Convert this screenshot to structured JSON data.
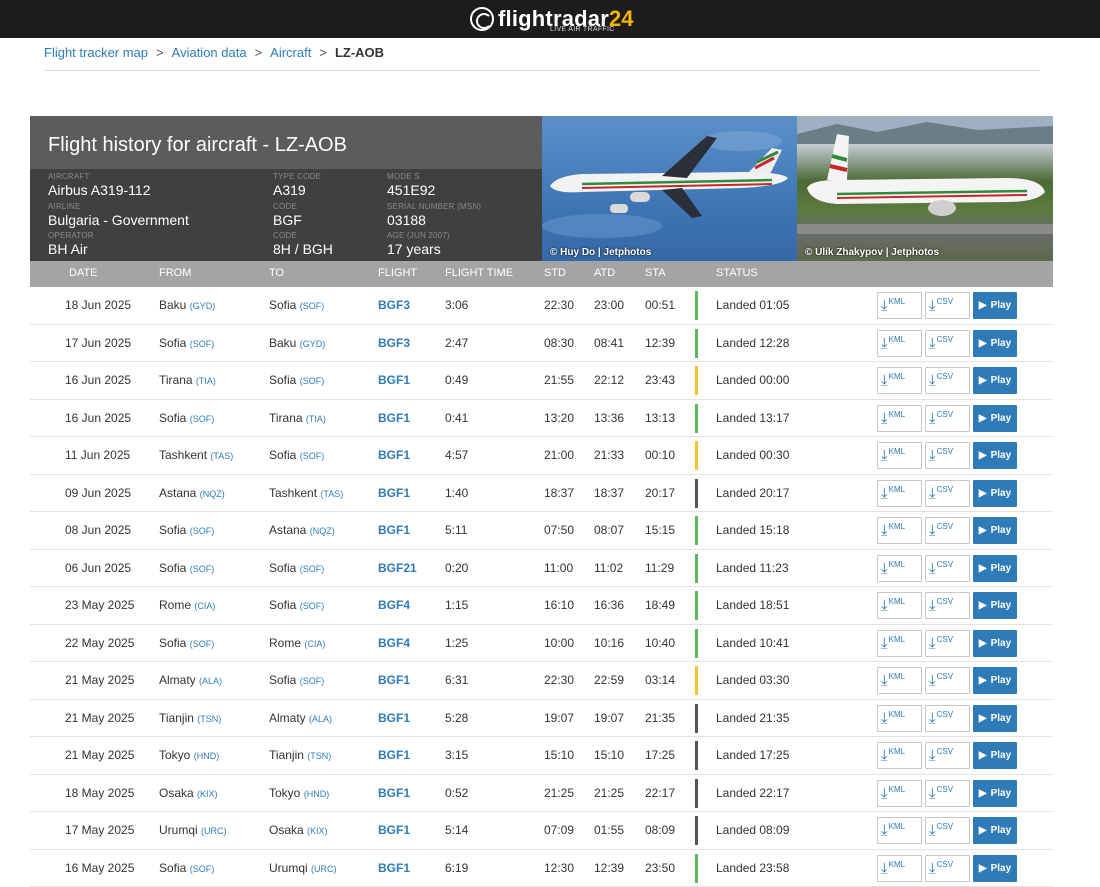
{
  "brand": {
    "name": "flightradar",
    "num": "24",
    "sub": "LIVE AIR TRAFFIC"
  },
  "breadcrumb": [
    "Flight tracker map",
    "Aviation data",
    "Aircraft",
    "LZ-AOB"
  ],
  "hero": {
    "title": "Flight history for aircraft - LZ-AOB",
    "aircraft_label": "AIRCRAFT",
    "aircraft": "Airbus A319-112",
    "airline_label": "AIRLINE",
    "airline": "Bulgaria - Government",
    "operator_label": "OPERATOR",
    "operator": "BH Air",
    "type_code_label": "TYPE CODE",
    "type_code": "A319",
    "code_label": "Code",
    "code1": "BGF",
    "code_label2": "Code",
    "code2": "8H / BGH",
    "mode_s_label": "MODE S",
    "mode_s": "451E92",
    "msn_label": "SERIAL NUMBER (MSN)",
    "msn": "03188",
    "age_label": "AGE (Jun 2007)",
    "age": "17 years",
    "photo1_credit": "© Huy Do | Jetphotos",
    "photo2_credit": "© Ulik Zhakypov | Jetphotos"
  },
  "columns": [
    "DATE",
    "FROM",
    "TO",
    "FLIGHT",
    "FLIGHT TIME",
    "STD",
    "ATD",
    "STA",
    "STATUS"
  ],
  "buttons": {
    "kml": "KML",
    "csv": "CSV",
    "play": "Play"
  },
  "status_colors": {
    "green": "#5cb85c",
    "yellow": "#f0c330",
    "gray": "#555555"
  },
  "rows": [
    {
      "date": "18 Jun 2025",
      "from": "Baku",
      "from_code": "(GYD)",
      "to": "Sofia",
      "to_code": "(SOF)",
      "flight": "BGF3",
      "time": "3:06",
      "std": "22:30",
      "atd": "23:00",
      "sta": "00:51",
      "status": "Landed 01:05",
      "color": "green"
    },
    {
      "date": "17 Jun 2025",
      "from": "Sofia",
      "from_code": "(SOF)",
      "to": "Baku",
      "to_code": "(GYD)",
      "flight": "BGF3",
      "time": "2:47",
      "std": "08:30",
      "atd": "08:41",
      "sta": "12:39",
      "status": "Landed 12:28",
      "color": "green"
    },
    {
      "date": "16 Jun 2025",
      "from": "Tirana",
      "from_code": "(TIA)",
      "to": "Sofia",
      "to_code": "(SOF)",
      "flight": "BGF1",
      "time": "0:49",
      "std": "21:55",
      "atd": "22:12",
      "sta": "23:43",
      "status": "Landed 00:00",
      "color": "yellow"
    },
    {
      "date": "16 Jun 2025",
      "from": "Sofia",
      "from_code": "(SOF)",
      "to": "Tirana",
      "to_code": "(TIA)",
      "flight": "BGF1",
      "time": "0:41",
      "std": "13:20",
      "atd": "13:36",
      "sta": "13:13",
      "status": "Landed 13:17",
      "color": "green"
    },
    {
      "date": "11 Jun 2025",
      "from": "Tashkent",
      "from_code": "(TAS)",
      "to": "Sofia",
      "to_code": "(SOF)",
      "flight": "BGF1",
      "time": "4:57",
      "std": "21:00",
      "atd": "21:33",
      "sta": "00:10",
      "status": "Landed 00:30",
      "color": "yellow"
    },
    {
      "date": "09 Jun 2025",
      "from": "Astana",
      "from_code": "(NQZ)",
      "to": "Tashkent",
      "to_code": "(TAS)",
      "flight": "BGF1",
      "time": "1:40",
      "std": "18:37",
      "atd": "18:37",
      "sta": "20:17",
      "status": "Landed 20:17",
      "color": "gray"
    },
    {
      "date": "08 Jun 2025",
      "from": "Sofia",
      "from_code": "(SOF)",
      "to": "Astana",
      "to_code": "(NQZ)",
      "flight": "BGF1",
      "time": "5:11",
      "std": "07:50",
      "atd": "08:07",
      "sta": "15:15",
      "status": "Landed 15:18",
      "color": "green"
    },
    {
      "date": "06 Jun 2025",
      "from": "Sofia",
      "from_code": "(SOF)",
      "to": "Sofia",
      "to_code": "(SOF)",
      "flight": "BGF21",
      "time": "0:20",
      "std": "11:00",
      "atd": "11:02",
      "sta": "11:29",
      "status": "Landed 11:23",
      "color": "green"
    },
    {
      "date": "23 May 2025",
      "from": "Rome",
      "from_code": "(CIA)",
      "to": "Sofia",
      "to_code": "(SOF)",
      "flight": "BGF4",
      "time": "1:15",
      "std": "16:10",
      "atd": "16:36",
      "sta": "18:49",
      "status": "Landed 18:51",
      "color": "green"
    },
    {
      "date": "22 May 2025",
      "from": "Sofia",
      "from_code": "(SOF)",
      "to": "Rome",
      "to_code": "(CIA)",
      "flight": "BGF4",
      "time": "1:25",
      "std": "10:00",
      "atd": "10:16",
      "sta": "10:40",
      "status": "Landed 10:41",
      "color": "green"
    },
    {
      "date": "21 May 2025",
      "from": "Almaty",
      "from_code": "(ALA)",
      "to": "Sofia",
      "to_code": "(SOF)",
      "flight": "BGF1",
      "time": "6:31",
      "std": "22:30",
      "atd": "22:59",
      "sta": "03:14",
      "status": "Landed 03:30",
      "color": "yellow"
    },
    {
      "date": "21 May 2025",
      "from": "Tianjin",
      "from_code": "(TSN)",
      "to": "Almaty",
      "to_code": "(ALA)",
      "flight": "BGF1",
      "time": "5:28",
      "std": "19:07",
      "atd": "19:07",
      "sta": "21:35",
      "status": "Landed 21:35",
      "color": "gray"
    },
    {
      "date": "21 May 2025",
      "from": "Tokyo",
      "from_code": "(HND)",
      "to": "Tianjin",
      "to_code": "(TSN)",
      "flight": "BGF1",
      "time": "3:15",
      "std": "15:10",
      "atd": "15:10",
      "sta": "17:25",
      "status": "Landed 17:25",
      "color": "gray"
    },
    {
      "date": "18 May 2025",
      "from": "Osaka",
      "from_code": "(KIX)",
      "to": "Tokyo",
      "to_code": "(HND)",
      "flight": "BGF1",
      "time": "0:52",
      "std": "21:25",
      "atd": "21:25",
      "sta": "22:17",
      "status": "Landed 22:17",
      "color": "gray"
    },
    {
      "date": "17 May 2025",
      "from": "Urumqi",
      "from_code": "(URC)",
      "to": "Osaka",
      "to_code": "(KIX)",
      "flight": "BGF1",
      "time": "5:14",
      "std": "07:09",
      "atd": "01:55",
      "sta": "08:09",
      "status": "Landed 08:09",
      "color": "gray"
    },
    {
      "date": "16 May 2025",
      "from": "Sofia",
      "from_code": "(SOF)",
      "to": "Urumqi",
      "to_code": "(URC)",
      "flight": "BGF1",
      "time": "6:19",
      "std": "12:30",
      "atd": "12:39",
      "sta": "23:50",
      "status": "Landed 23:58",
      "color": "green"
    }
  ]
}
